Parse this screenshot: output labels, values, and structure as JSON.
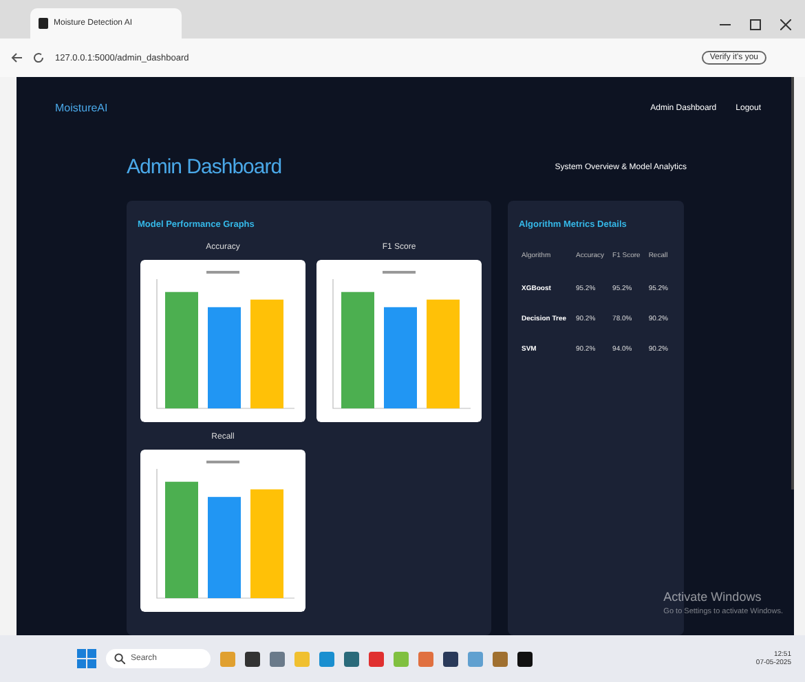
{
  "browser": {
    "tab_title": "Moisture Detection AI",
    "address": "127.0.0.1:5000/admin_dashboard",
    "profile_chip": "Verify it's you"
  },
  "navbar": {
    "brand": "MoistureAI",
    "links": [
      "Admin Dashboard",
      "Logout"
    ]
  },
  "header": {
    "title": "Admin Dashboard",
    "subtitle": "System Overview & Model Analytics"
  },
  "graphs_panel": {
    "title": "Model Performance Graphs",
    "graphs": [
      {
        "label": "Accuracy"
      },
      {
        "label": "F1 Score"
      },
      {
        "label": "Recall"
      }
    ]
  },
  "metrics_panel": {
    "title": "Algorithm Metrics Details",
    "columns": [
      "Algorithm",
      "Accuracy",
      "F1 Score",
      "Recall"
    ],
    "rows": [
      [
        "XGBoost",
        "95.2%",
        "95.2%",
        "95.2%"
      ],
      [
        "Decision Tree",
        "90.2%",
        "78.0%",
        "90.2%"
      ],
      [
        "SVM",
        "90.2%",
        "94.0%",
        "90.2%"
      ]
    ]
  },
  "os_notice": {
    "title": "Activate Windows",
    "text": "Go to Settings to activate Windows."
  },
  "taskbar": {
    "search": "Search",
    "time": "12:51",
    "date": "07-05-2025"
  }
}
